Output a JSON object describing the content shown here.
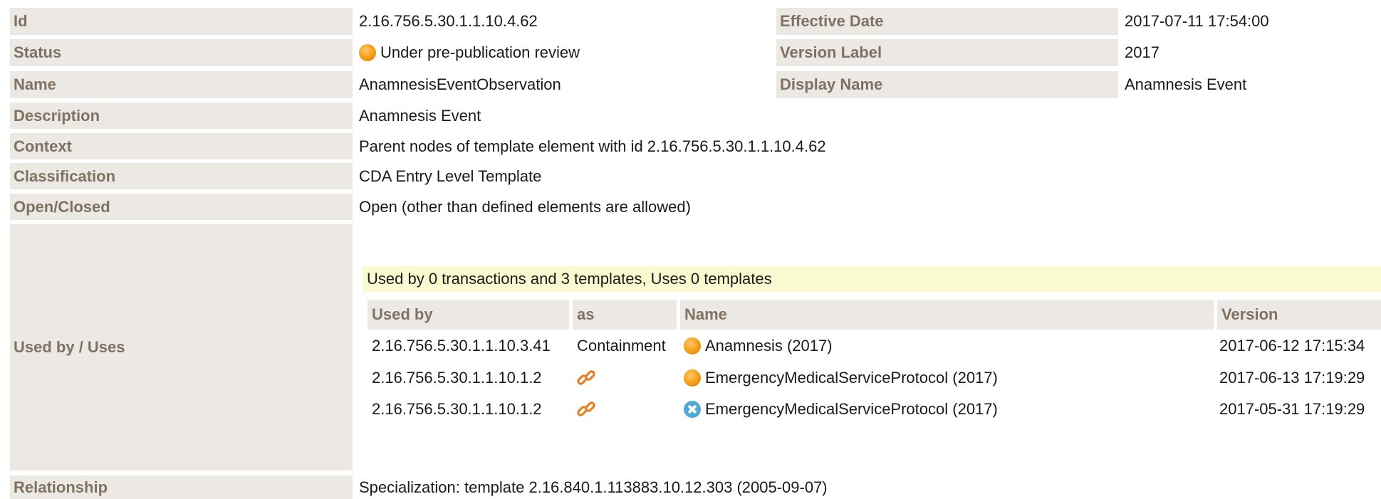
{
  "fields": {
    "id": {
      "label": "Id",
      "value": "2.16.756.5.30.1.1.10.4.62"
    },
    "effective_date": {
      "label": "Effective Date",
      "value": "2017-07-11 17:54:00"
    },
    "status": {
      "label": "Status",
      "value": "Under pre-publication review",
      "icon": "status-orange-dot-icon"
    },
    "version_label": {
      "label": "Version Label",
      "value": "2017"
    },
    "name": {
      "label": "Name",
      "value": "AnamnesisEventObservation"
    },
    "display_name": {
      "label": "Display Name",
      "value": "Anamnesis Event"
    },
    "description": {
      "label": "Description",
      "value": "Anamnesis Event"
    },
    "context": {
      "label": "Context",
      "value": "Parent nodes of template element with id 2.16.756.5.30.1.1.10.4.62"
    },
    "classification": {
      "label": "Classification",
      "value": "CDA Entry Level Template"
    },
    "open_closed": {
      "label": "Open/Closed",
      "value": "Open (other than defined elements are allowed)"
    },
    "used_by": {
      "label": "Used by / Uses"
    },
    "relationship": {
      "label": "Relationship",
      "value": "Specialization: template 2.16.840.1.113883.10.12.303 (2005-09-07)"
    }
  },
  "usage": {
    "summary": "Used by 0 transactions and 3 templates, Uses 0 templates",
    "headers": {
      "used_by": "Used by",
      "as": "as",
      "name": "Name",
      "version": "Version"
    },
    "rows": [
      {
        "used_by": "2.16.756.5.30.1.1.10.3.41",
        "as": "Containment",
        "as_icon": null,
        "status_icon": "status-orange-dot-icon",
        "name": "Anamnesis (2017)",
        "version": "2017-06-12 17:15:34"
      },
      {
        "used_by": "2.16.756.5.30.1.1.10.1.2",
        "as": "",
        "as_icon": "link-icon",
        "status_icon": "status-orange-dot-icon",
        "name": "EmergencyMedicalServiceProtocol (2017)",
        "version": "2017-06-13 17:19:29"
      },
      {
        "used_by": "2.16.756.5.30.1.1.10.1.2",
        "as": "",
        "as_icon": "link-icon",
        "status_icon": "status-cancelled-blue-icon",
        "name": "EmergencyMedicalServiceProtocol (2017)",
        "version": "2017-05-31 17:19:29"
      }
    ]
  },
  "colors": {
    "label_bg": "#ece8e3",
    "label_text": "#7f7263",
    "banner_bg": "#fafad0",
    "status_orange": "#f39c12",
    "status_blue": "#4fa8d8",
    "link_icon": "#e67e22"
  }
}
